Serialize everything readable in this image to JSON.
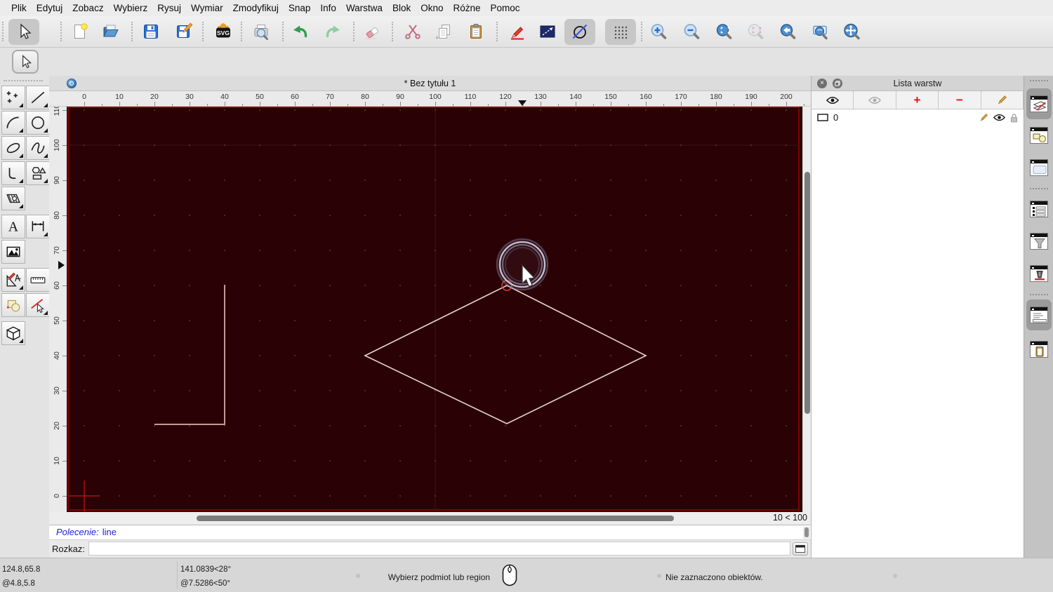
{
  "menu": {
    "items": [
      "Plik",
      "Edytuj",
      "Zobacz",
      "Wybierz",
      "Rysuj",
      "Wymiar",
      "Zmodyfikuj",
      "Snap",
      "Info",
      "Warstwa",
      "Blok",
      "Okno",
      "Różne",
      "Pomoc"
    ]
  },
  "toolbar": {
    "buttons": [
      "select",
      "new-document",
      "open-file",
      "save",
      "save-as",
      "svg-export",
      "print-preview",
      "undo",
      "redo",
      "eraser",
      "cut",
      "copy",
      "paste",
      "pen-attributes",
      "line-attributes",
      "draft-mode",
      "grid-toggle",
      "zoom-in",
      "zoom-out",
      "zoom-auto",
      "zoom-selection",
      "zoom-previous",
      "zoom-window",
      "zoom-pan"
    ],
    "active_buttons": [
      "select",
      "draft-mode",
      "grid-toggle"
    ],
    "disabled_buttons": [
      "zoom-selection"
    ]
  },
  "left_toolbar": {
    "tools": [
      "points",
      "line",
      "arc",
      "circle",
      "ellipse",
      "spline",
      "polyline",
      "shapes",
      "hatch",
      "text",
      "dimension",
      "image",
      "modify",
      "measure",
      "info-order",
      "deselect",
      "solid-3d"
    ]
  },
  "document": {
    "title": "* Bez tytułu 1"
  },
  "rulers": {
    "h_labels": [
      "0",
      "10",
      "20",
      "30",
      "40",
      "50",
      "60",
      "70",
      "80",
      "90",
      "100",
      "110",
      "120",
      "130",
      "140",
      "150",
      "160",
      "170",
      "180",
      "190",
      "200"
    ],
    "v_labels": [
      "0",
      "10",
      "20",
      "30",
      "40",
      "50",
      "60",
      "70",
      "80",
      "90",
      "100",
      "110"
    ]
  },
  "canvas": {
    "background": "#2a0205",
    "sheet_border_color": "#bf0000",
    "meta_grid_color": "#3f1412",
    "grid_dot_color": "#604a4a",
    "origin_color": "#cc1111"
  },
  "drawing": {
    "units_per_grid": 10,
    "cursor": [
      124.8,
      65.8
    ],
    "polyline": [
      [
        40,
        60.2
      ],
      [
        40,
        20.4
      ],
      [
        20,
        20.4
      ]
    ],
    "diamond": [
      [
        120.4,
        60
      ],
      [
        160,
        40
      ],
      [
        120.4,
        20.6
      ],
      [
        80,
        40
      ]
    ],
    "snap_marker": [
      120.4,
      60
    ],
    "line_color": "#c69898",
    "diamond_color": "#ead0d0"
  },
  "grid_status": "10 < 100",
  "command": {
    "history_label": "Polecenie:",
    "history_value": "line",
    "prompt_label": "Rozkaz:"
  },
  "layer_panel": {
    "title": "Lista warstw",
    "toolbar": [
      "show-all-layers",
      "hide-all-layers",
      "add-layer",
      "remove-layer",
      "edit-layer"
    ],
    "layers": [
      {
        "name": "0"
      }
    ]
  },
  "dock": {
    "buttons": [
      "layer-list",
      "block-list",
      "library-browser",
      "entity-list",
      "selection-filter",
      "pen-palette",
      "command-widget",
      "clipboard"
    ]
  },
  "status_bar": {
    "abs_coord": "124.8,65.8",
    "rel_coord": "@4.8,5.8",
    "polar_abs": "141.0839<28°",
    "polar_rel": "@7.5286<50°",
    "hint": "Wybierz podmiot lub region",
    "selection_info": "Nie zaznaczono obiektów."
  }
}
